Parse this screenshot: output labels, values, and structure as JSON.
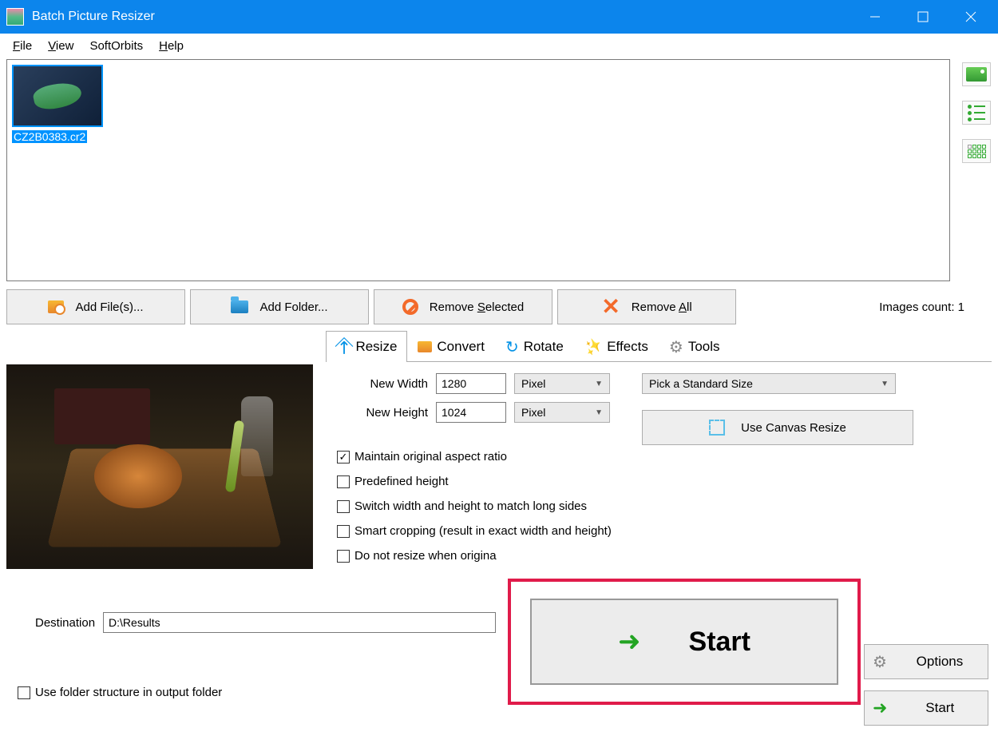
{
  "window": {
    "title": "Batch Picture Resizer"
  },
  "menu": {
    "file": "File",
    "view": "View",
    "softorbits": "SoftOrbits",
    "help": "Help"
  },
  "thumbnail": {
    "filename": "CZ2B0383.cr2"
  },
  "toolbar": {
    "add_files": "Add File(s)...",
    "add_folder": "Add Folder...",
    "remove_selected": "Remove Selected",
    "remove_all": "Remove All",
    "images_count_label": "Images count: 1"
  },
  "tabs": {
    "resize": "Resize",
    "convert": "Convert",
    "rotate": "Rotate",
    "effects": "Effects",
    "tools": "Tools"
  },
  "resize": {
    "new_width_label": "New Width",
    "new_width_value": "1280",
    "new_height_label": "New Height",
    "new_height_value": "1024",
    "unit": "Pixel",
    "standard_size": "Pick a Standard Size",
    "maintain_ratio": "Maintain original aspect ratio",
    "predefined_height": "Predefined height",
    "switch_wh": "Switch width and height to match long sides",
    "smart_crop": "Smart cropping (result in exact width and height)",
    "do_not_resize": "Do not resize when origina",
    "canvas_resize": "Use Canvas Resize"
  },
  "destination": {
    "label": "Destination",
    "value": "D:\\Results"
  },
  "folder_structure": "Use folder structure in output folder",
  "buttons": {
    "options": "Options",
    "start": "Start",
    "big_start": "Start"
  }
}
